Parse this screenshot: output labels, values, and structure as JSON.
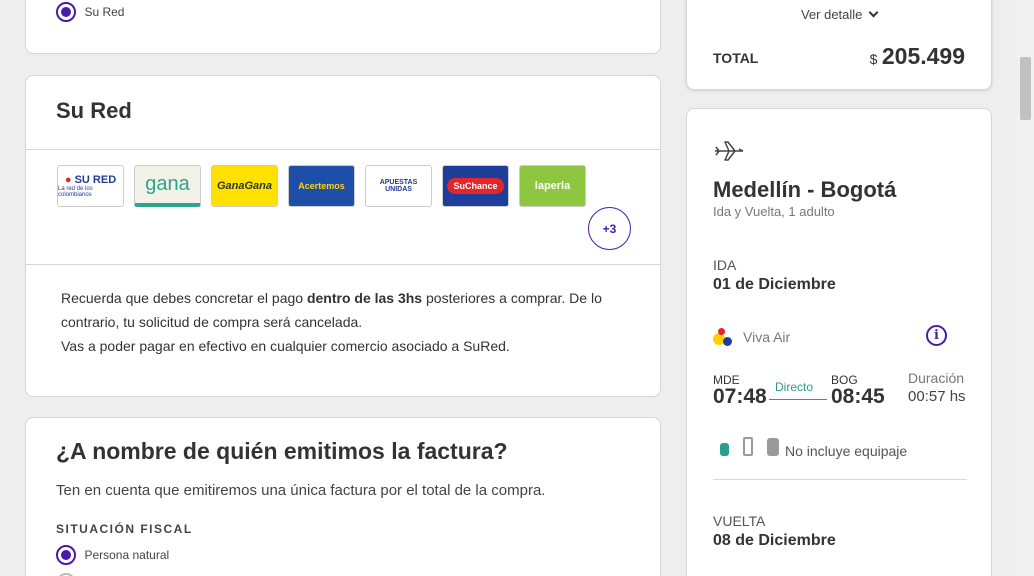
{
  "payment_option": {
    "label": "Su Red"
  },
  "sured_card": {
    "title": "Su Red",
    "logos": [
      {
        "name": "sured-logo",
        "text": "SU RED",
        "sub": "La red de los colombianos"
      },
      {
        "name": "gana-logo",
        "text": "gana"
      },
      {
        "name": "gana-gana-logo",
        "text": "GanaGana"
      },
      {
        "name": "acertemos-logo",
        "text": "Acertemos"
      },
      {
        "name": "apuestas-unidas-logo",
        "text": "APUESTAS UNIDAS"
      },
      {
        "name": "suchance-logo",
        "text": "SuChance"
      },
      {
        "name": "laperla-logo",
        "text": "laperla"
      }
    ],
    "more_label": "+3",
    "info_line1_a": "Recuerda que debes concretar el pago ",
    "info_line1_b": "dentro de las 3hs",
    "info_line1_c": " posteriores a comprar. De lo",
    "info_line2": "contrario, tu solicitud de compra será cancelada.",
    "info_line3": "Vas a poder pagar en efectivo en cualquier comercio asociado a SuRed."
  },
  "invoice_card": {
    "title": "¿A nombre de quién emitimos la factura?",
    "subtitle": "Ten en cuenta que emitiremos una única factura por el total de la compra.",
    "fiscal_label": "SITUACIÓN FISCAL",
    "option_natural": "Persona natural"
  },
  "total_card": {
    "detail_label": "Ver detalle",
    "total_label": "TOTAL",
    "currency": "$",
    "amount": "205.499"
  },
  "flight_card": {
    "route": "Medellín - Bogotá",
    "trip_info": "Ida y Vuelta, 1 adulto",
    "outbound_label": "IDA",
    "outbound_date": "01 de Diciembre",
    "airline": "Viva Air",
    "origin_code": "MDE",
    "origin_time": "07:48",
    "stops": "Directo",
    "dest_code": "BOG",
    "dest_time": "08:45",
    "duration_label": "Duración",
    "duration_value": "00:57 hs",
    "baggage": "No incluye equipaje",
    "return_label": "VUELTA",
    "return_date": "08 de Diciembre"
  },
  "colors": {
    "accent": "#4a1aa8",
    "direct": "#2a9d8f"
  }
}
